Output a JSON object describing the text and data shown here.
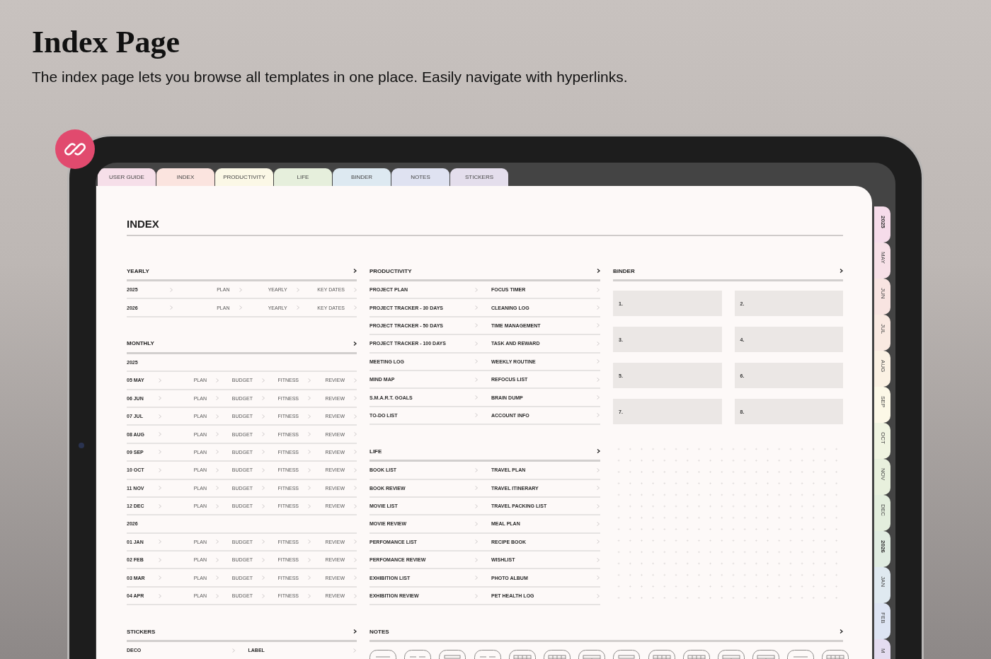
{
  "header": {
    "title": "Index Page",
    "subtitle": "The index page lets you browse all templates in one place. Easily navigate with hyperlinks."
  },
  "top_tabs": [
    {
      "label": "USER GUIDE",
      "color": "#f6dfe9"
    },
    {
      "label": "INDEX",
      "color": "#fbe4df"
    },
    {
      "label": "PRODUCTIVITY",
      "color": "#fbf8e6"
    },
    {
      "label": "LIFE",
      "color": "#e6efdc"
    },
    {
      "label": "BINDER",
      "color": "#dde9f1"
    },
    {
      "label": "NOTES",
      "color": "#dfe2f1"
    },
    {
      "label": "STICKERS",
      "color": "#e4deec"
    }
  ],
  "page": {
    "title": "INDEX",
    "yearly": {
      "title": "YEARLY",
      "rows": [
        [
          "2025",
          "PLAN",
          "YEARLY",
          "KEY DATES"
        ],
        [
          "2026",
          "PLAN",
          "YEARLY",
          "KEY DATES"
        ]
      ]
    },
    "monthly": {
      "title": "MONTHLY",
      "groups": [
        {
          "year": "2025",
          "rows": [
            [
              "05 MAY",
              "PLAN",
              "BUDGET",
              "FITNESS",
              "REVIEW"
            ],
            [
              "06 JUN",
              "PLAN",
              "BUDGET",
              "FITNESS",
              "REVIEW"
            ],
            [
              "07 JUL",
              "PLAN",
              "BUDGET",
              "FITNESS",
              "REVIEW"
            ],
            [
              "08 AUG",
              "PLAN",
              "BUDGET",
              "FITNESS",
              "REVIEW"
            ],
            [
              "09 SEP",
              "PLAN",
              "BUDGET",
              "FITNESS",
              "REVIEW"
            ],
            [
              "10 OCT",
              "PLAN",
              "BUDGET",
              "FITNESS",
              "REVIEW"
            ],
            [
              "11 NOV",
              "PLAN",
              "BUDGET",
              "FITNESS",
              "REVIEW"
            ],
            [
              "12 DEC",
              "PLAN",
              "BUDGET",
              "FITNESS",
              "REVIEW"
            ]
          ]
        },
        {
          "year": "2026",
          "rows": [
            [
              "01 JAN",
              "PLAN",
              "BUDGET",
              "FITNESS",
              "REVIEW"
            ],
            [
              "02 FEB",
              "PLAN",
              "BUDGET",
              "FITNESS",
              "REVIEW"
            ],
            [
              "03 MAR",
              "PLAN",
              "BUDGET",
              "FITNESS",
              "REVIEW"
            ],
            [
              "04 APR",
              "PLAN",
              "BUDGET",
              "FITNESS",
              "REVIEW"
            ]
          ]
        }
      ]
    },
    "productivity": {
      "title": "PRODUCTIVITY",
      "rows": [
        [
          "PROJECT PLAN",
          "FOCUS TIMER"
        ],
        [
          "PROJECT TRACKER - 30 DAYS",
          "CLEANING LOG"
        ],
        [
          "PROJECT TRACKER - 50 DAYS",
          "TIME MANAGEMENT"
        ],
        [
          "PROJECT TRACKER - 100 DAYS",
          "TASK AND REWARD"
        ],
        [
          "MEETING LOG",
          "WEEKLY ROUTINE"
        ],
        [
          "MIND MAP",
          "REFOCUS LIST"
        ],
        [
          "S.M.A.R.T. GOALS",
          "BRAIN DUMP"
        ],
        [
          "TO-DO LIST",
          "ACCOUNT INFO"
        ]
      ]
    },
    "life": {
      "title": "LIFE",
      "rows": [
        [
          "BOOK LIST",
          "TRAVEL PLAN"
        ],
        [
          "BOOK REVIEW",
          "TRAVEL ITINERARY"
        ],
        [
          "MOVIE LIST",
          "TRAVEL PACKING LIST"
        ],
        [
          "MOVIE REVIEW",
          "MEAL PLAN"
        ],
        [
          "PERFOMANCE LIST",
          "RECIPE BOOK"
        ],
        [
          "PERFOMANCE REVIEW",
          "WISHLIST"
        ],
        [
          "EXHIBITION LIST",
          "PHOTO ALBUM"
        ],
        [
          "EXHIBITION REVIEW",
          "PET HEALTH LOG"
        ]
      ]
    },
    "binder": {
      "title": "BINDER",
      "slots": [
        "1.",
        "2.",
        "3.",
        "4.",
        "5.",
        "6.",
        "7.",
        "8."
      ]
    },
    "stickers": {
      "title": "STICKERS",
      "rows": [
        [
          "DECO",
          "LABEL"
        ]
      ]
    },
    "notes": {
      "title": "NOTES",
      "templates": [
        {
          "kind": "lined"
        },
        {
          "kind": "columns"
        },
        {
          "kind": "list"
        },
        {
          "kind": "columns"
        },
        {
          "kind": "table"
        },
        {
          "kind": "table"
        },
        {
          "kind": "grid"
        },
        {
          "kind": "list"
        },
        {
          "kind": "table"
        },
        {
          "kind": "table"
        },
        {
          "kind": "grid"
        },
        {
          "kind": "grid"
        },
        {
          "kind": "lined"
        },
        {
          "kind": "table"
        }
      ]
    }
  },
  "side_tabs": [
    {
      "label": "2025",
      "kind": "year",
      "color": "#f6dcea"
    },
    {
      "label": "MAY",
      "kind": "month",
      "color": "#f7e0e7"
    },
    {
      "label": "JUN",
      "kind": "month",
      "color": "#f8e4e1"
    },
    {
      "label": "JUL",
      "kind": "month",
      "color": "#f9e9e1"
    },
    {
      "label": "AUG",
      "kind": "month",
      "color": "#fbf1e3"
    },
    {
      "label": "SEP",
      "kind": "month",
      "color": "#fcf8e7"
    },
    {
      "label": "OCT",
      "kind": "month",
      "color": "#f0f4e1"
    },
    {
      "label": "NOV",
      "kind": "month",
      "color": "#e8f0dd"
    },
    {
      "label": "DEC",
      "kind": "month",
      "color": "#e3eedd"
    },
    {
      "label": "2026",
      "kind": "year",
      "color": "#e0ece1"
    },
    {
      "label": "JAN",
      "kind": "month",
      "color": "#dfe9f0"
    },
    {
      "label": "FEB",
      "kind": "month",
      "color": "#dde4f3"
    },
    {
      "label": "M",
      "kind": "month",
      "color": "#e4dcf0"
    }
  ]
}
